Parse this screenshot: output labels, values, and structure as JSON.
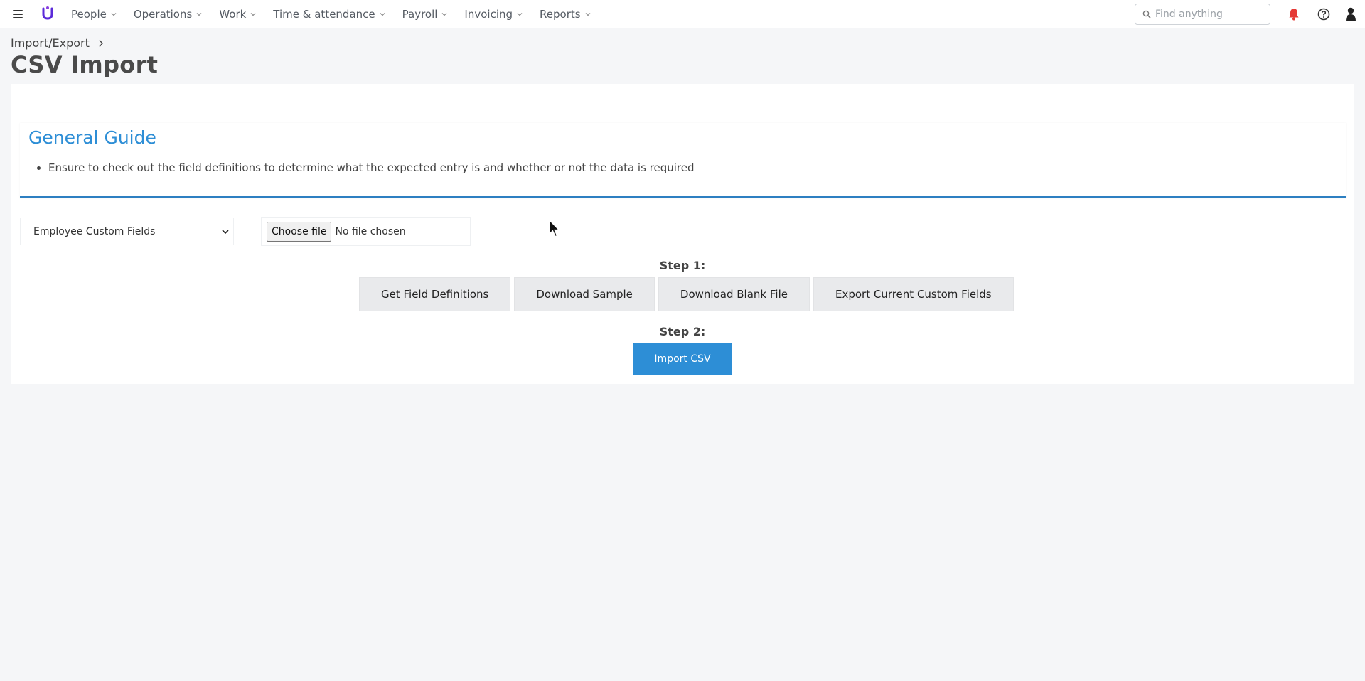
{
  "topbar": {
    "nav_items": [
      "People",
      "Operations",
      "Work",
      "Time & attendance",
      "Payroll",
      "Invoicing",
      "Reports"
    ],
    "search_placeholder": "Find anything",
    "icons": [
      "menu-icon",
      "logo-icon",
      "search-icon",
      "bell-icon",
      "help-icon",
      "user-icon"
    ],
    "accent_color": "#2d8ed6",
    "bell_color": "#e53935",
    "logo_color": "#5b2bd9"
  },
  "header": {
    "breadcrumb": "Import/Export",
    "title": "CSV Import"
  },
  "guide": {
    "title": "General Guide",
    "items": [
      "Ensure to check out the field definitions to determine what the expected entry is and whether or not the data is required"
    ]
  },
  "form": {
    "import_type": "Employee Custom Fields",
    "file_button": "Choose file",
    "file_status": "No file chosen"
  },
  "step1": {
    "label": "Step 1:",
    "buttons": [
      "Get Field Definitions",
      "Download Sample",
      "Download Blank File",
      "Export Current Custom Fields"
    ]
  },
  "step2": {
    "label": "Step 2:",
    "button": "Import CSV"
  }
}
